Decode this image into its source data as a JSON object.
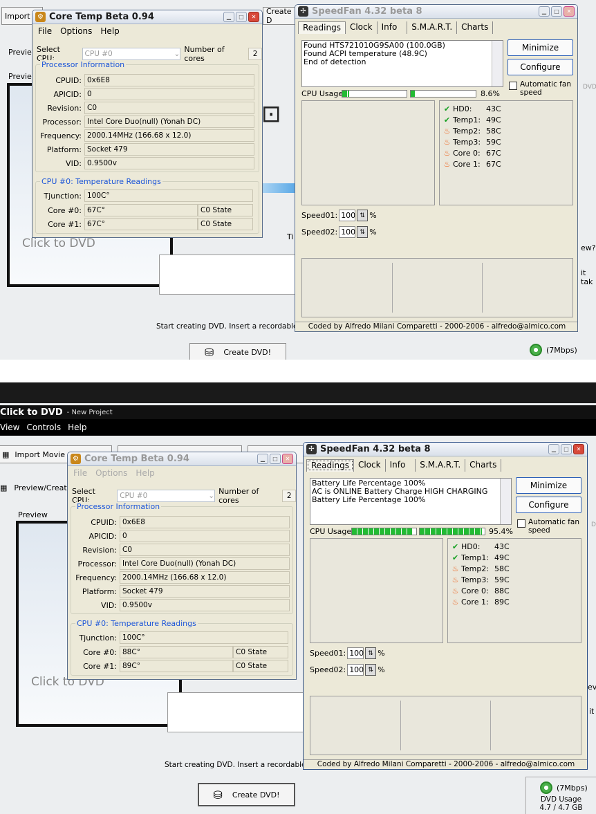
{
  "top": {
    "dvd": {
      "import_label": "Import M",
      "preview_label": "Previe",
      "preview2_label": "Previe",
      "create_partial": "Create D",
      "click_to_dvd": "Click to DVD",
      "status_text": "Start creating DVD. Insert a recordable D",
      "create_dvd_label": "Create DVD!",
      "speed_label": "(7Mbps)",
      "right_text1": "DVD",
      "right_text2": "ew?",
      "right_text3": "it tak",
      "ti_partial": "Ti"
    },
    "coretemp": {
      "title": "Core Temp Beta 0.94",
      "menu": [
        "File",
        "Options",
        "Help"
      ],
      "select_cpu_label": "Select CPU:",
      "select_cpu_value": "CPU #0",
      "cores_label": "Number of cores",
      "cores_value": "2",
      "proc_group": "Processor Information",
      "fields": [
        {
          "label": "CPUID:",
          "value": "0x6E8"
        },
        {
          "label": "APICID:",
          "value": "0"
        },
        {
          "label": "Revision:",
          "value": "C0"
        },
        {
          "label": "Processor:",
          "value": "Intel Core Duo(null) (Yonah DC)"
        },
        {
          "label": "Frequency:",
          "value": "2000.14MHz (166.68 x 12.0)"
        },
        {
          "label": "Platform:",
          "value": "Socket 479"
        },
        {
          "label": "VID:",
          "value": "0.9500v"
        }
      ],
      "temp_group": "CPU #0: Temperature Readings",
      "tjunction_label": "Tjunction:",
      "tjunction_value": "100C°",
      "cores": [
        {
          "label": "Core #0:",
          "value": "67C°",
          "state": "C0 State"
        },
        {
          "label": "Core #1:",
          "value": "67C°",
          "state": "C0 State"
        }
      ]
    },
    "speedfan": {
      "title": "SpeedFan 4.32 beta 8",
      "tabs": [
        "Readings",
        "Clock",
        "Info",
        "S.M.A.R.T.",
        "Charts"
      ],
      "log": [
        "Found HTS721010G9SA00 (100.0GB)",
        "Found ACPI temperature (48.9C)",
        "End of detection"
      ],
      "minimize": "Minimize",
      "configure": "Configure",
      "auto_fan": "Automatic fan speed",
      "cpu_usage_label": "CPU Usage",
      "cpu_usage_value": "8.6%",
      "cpu_bar1": 0.11,
      "cpu_bar2": 0.06,
      "temps": [
        {
          "icon": "check",
          "label": "HD0:",
          "value": "43C"
        },
        {
          "icon": "check",
          "label": "Temp1:",
          "value": "49C"
        },
        {
          "icon": "fire",
          "label": "Temp2:",
          "value": "58C"
        },
        {
          "icon": "fire",
          "label": "Temp3:",
          "value": "59C"
        },
        {
          "icon": "fire",
          "label": "Core 0:",
          "value": "67C"
        },
        {
          "icon": "fire",
          "label": "Core 1:",
          "value": "67C"
        }
      ],
      "speed01_label": "Speed01:",
      "speed01_value": "100",
      "speed02_label": "Speed02:",
      "speed02_value": "100",
      "percent": "%",
      "footer": "Coded by Alfredo Milani Comparetti - 2000-2006 - alfredo@almico.com"
    }
  },
  "bottom": {
    "app_title": "Click to DVD",
    "app_subtitle": "- New Project",
    "menu": [
      "View",
      "Controls",
      "Help"
    ],
    "dvd": {
      "import_label": "Import Movie",
      "preview_create_label": "Preview/Create",
      "preview_label": "Preview",
      "click_to_dvd": "Click to DVD",
      "status_text": "Start creating DVD. Insert a recordable D",
      "create_dvd_label": "Create DVD!",
      "speed_label": "(7Mbps)",
      "dvd_usage_label": "DVD Usage",
      "dvd_usage_value": "4.7 / 4.7 GB",
      "right_text1": "D",
      "right_text2": "ev",
      "right_text3": "it"
    },
    "coretemp": {
      "title": "Core Temp Beta 0.94",
      "menu": [
        "File",
        "Options",
        "Help"
      ],
      "select_cpu_label": "Select CPU:",
      "select_cpu_value": "CPU #0",
      "cores_label": "Number of cores",
      "cores_value": "2",
      "proc_group": "Processor Information",
      "fields": [
        {
          "label": "CPUID:",
          "value": "0x6E8"
        },
        {
          "label": "APICID:",
          "value": "0"
        },
        {
          "label": "Revision:",
          "value": "C0"
        },
        {
          "label": "Processor:",
          "value": "Intel Core Duo(null) (Yonah DC)"
        },
        {
          "label": "Frequency:",
          "value": "2000.14MHz (166.68 x 12.0)"
        },
        {
          "label": "Platform:",
          "value": "Socket 479"
        },
        {
          "label": "VID:",
          "value": "0.9500v"
        }
      ],
      "temp_group": "CPU #0: Temperature Readings",
      "tjunction_label": "Tjunction:",
      "tjunction_value": "100C°",
      "cores": [
        {
          "label": "Core #0:",
          "value": "88C°",
          "state": "C0 State"
        },
        {
          "label": "Core #1:",
          "value": "89C°",
          "state": "C0 State"
        }
      ]
    },
    "speedfan": {
      "title": "SpeedFan 4.32 beta 8",
      "tabs": [
        "Readings",
        "Clock",
        "Info",
        "S.M.A.R.T.",
        "Charts"
      ],
      "log": [
        "Battery Life Percentage 100%",
        "AC is ONLINE Battery Charge HIGH CHARGING",
        "Battery Life Percentage 100%"
      ],
      "minimize": "Minimize",
      "configure": "Configure",
      "auto_fan": "Automatic fan speed",
      "cpu_usage_label": "CPU Usage",
      "cpu_usage_value": "95.4%",
      "cpu_bar1": 0.95,
      "cpu_bar2": 0.96,
      "temps": [
        {
          "icon": "check",
          "label": "HD0:",
          "value": "43C"
        },
        {
          "icon": "check",
          "label": "Temp1:",
          "value": "49C"
        },
        {
          "icon": "fire",
          "label": "Temp2:",
          "value": "58C"
        },
        {
          "icon": "fire",
          "label": "Temp3:",
          "value": "59C"
        },
        {
          "icon": "fire",
          "label": "Core 0:",
          "value": "88C"
        },
        {
          "icon": "fire",
          "label": "Core 1:",
          "value": "89C"
        }
      ],
      "speed01_label": "Speed01:",
      "speed01_value": "100",
      "speed02_label": "Speed02:",
      "speed02_value": "100",
      "percent": "%",
      "footer": "Coded by Alfredo Milani Comparetti - 2000-2006 - alfredo@almico.com"
    }
  }
}
